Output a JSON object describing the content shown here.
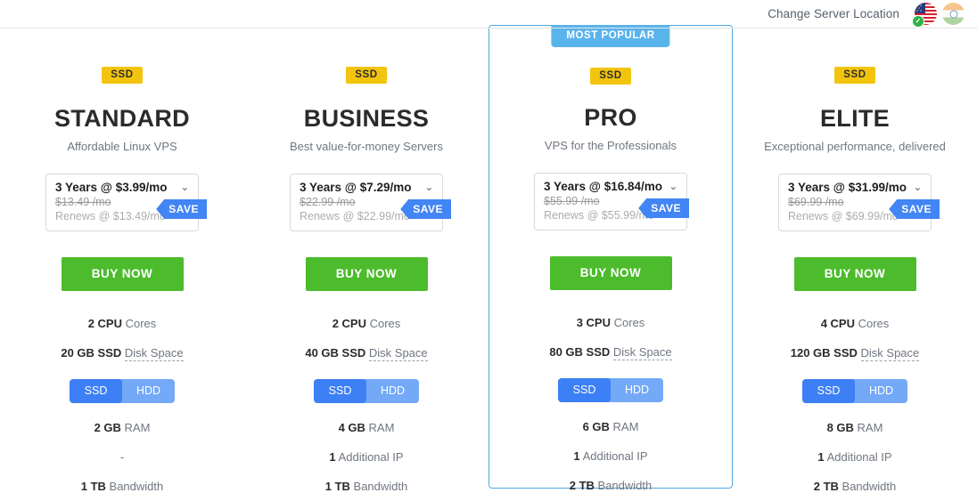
{
  "header": {
    "change_location_label": "Change Server Location",
    "flags": [
      {
        "name": "us-flag",
        "selected": true,
        "check": "✓"
      },
      {
        "name": "india-flag",
        "selected": false,
        "check": ""
      }
    ]
  },
  "toggle": {
    "ssd_label": "SSD",
    "hdd_label": "HDD"
  },
  "badge_label": "SSD",
  "popular_label": "MOST POPULAR",
  "buy_label": "BUY NOW",
  "save_label": "SAVE",
  "chevron": "⌄",
  "colors": {
    "accent_blue": "#4285f4",
    "featured_border": "#4fa8e0",
    "popular_banner": "#5ab4ec",
    "badge_yellow": "#f3c40d",
    "buy_green": "#4cbb2c",
    "toggle_active": "#3d7ff5",
    "toggle_track": "#74a9f8"
  },
  "plans": [
    {
      "name": "STANDARD",
      "tagline": "Affordable Linux VPS",
      "featured": false,
      "price_term": "3 Years @ $3.99/mo",
      "price_old": "$13.49 /mo",
      "price_renew": "Renews @ $13.49/mo",
      "cpu": "2 CPU",
      "cpu_label": "Cores",
      "disk": "20 GB SSD",
      "disk_label": "Disk Space",
      "ram": "2 GB",
      "ram_label": "RAM",
      "ip": "-",
      "ip_label": "",
      "bandwidth": "1 TB",
      "bandwidth_label": "Bandwidth"
    },
    {
      "name": "BUSINESS",
      "tagline": "Best value-for-money Servers",
      "featured": false,
      "price_term": "3 Years @ $7.29/mo",
      "price_old": "$22.99 /mo",
      "price_renew": "Renews @ $22.99/mo",
      "cpu": "2 CPU",
      "cpu_label": "Cores",
      "disk": "40 GB SSD",
      "disk_label": "Disk Space",
      "ram": "4 GB",
      "ram_label": "RAM",
      "ip": "1",
      "ip_label": "Additional IP",
      "bandwidth": "1 TB",
      "bandwidth_label": "Bandwidth"
    },
    {
      "name": "PRO",
      "tagline": "VPS for the Professionals",
      "featured": true,
      "price_term": "3 Years @ $16.84/mo",
      "price_old": "$55.99 /mo",
      "price_renew": "Renews @ $55.99/mo",
      "cpu": "3 CPU",
      "cpu_label": "Cores",
      "disk": "80 GB SSD",
      "disk_label": "Disk Space",
      "ram": "6 GB",
      "ram_label": "RAM",
      "ip": "1",
      "ip_label": "Additional IP",
      "bandwidth": "2 TB",
      "bandwidth_label": "Bandwidth"
    },
    {
      "name": "ELITE",
      "tagline": "Exceptional performance, delivered",
      "featured": false,
      "price_term": "3 Years @ $31.99/mo",
      "price_old": "$69.99 /mo",
      "price_renew": "Renews @ $69.99/mo",
      "cpu": "4 CPU",
      "cpu_label": "Cores",
      "disk": "120 GB SSD",
      "disk_label": "Disk Space",
      "ram": "8 GB",
      "ram_label": "RAM",
      "ip": "1",
      "ip_label": "Additional IP",
      "bandwidth": "2 TB",
      "bandwidth_label": "Bandwidth"
    }
  ]
}
